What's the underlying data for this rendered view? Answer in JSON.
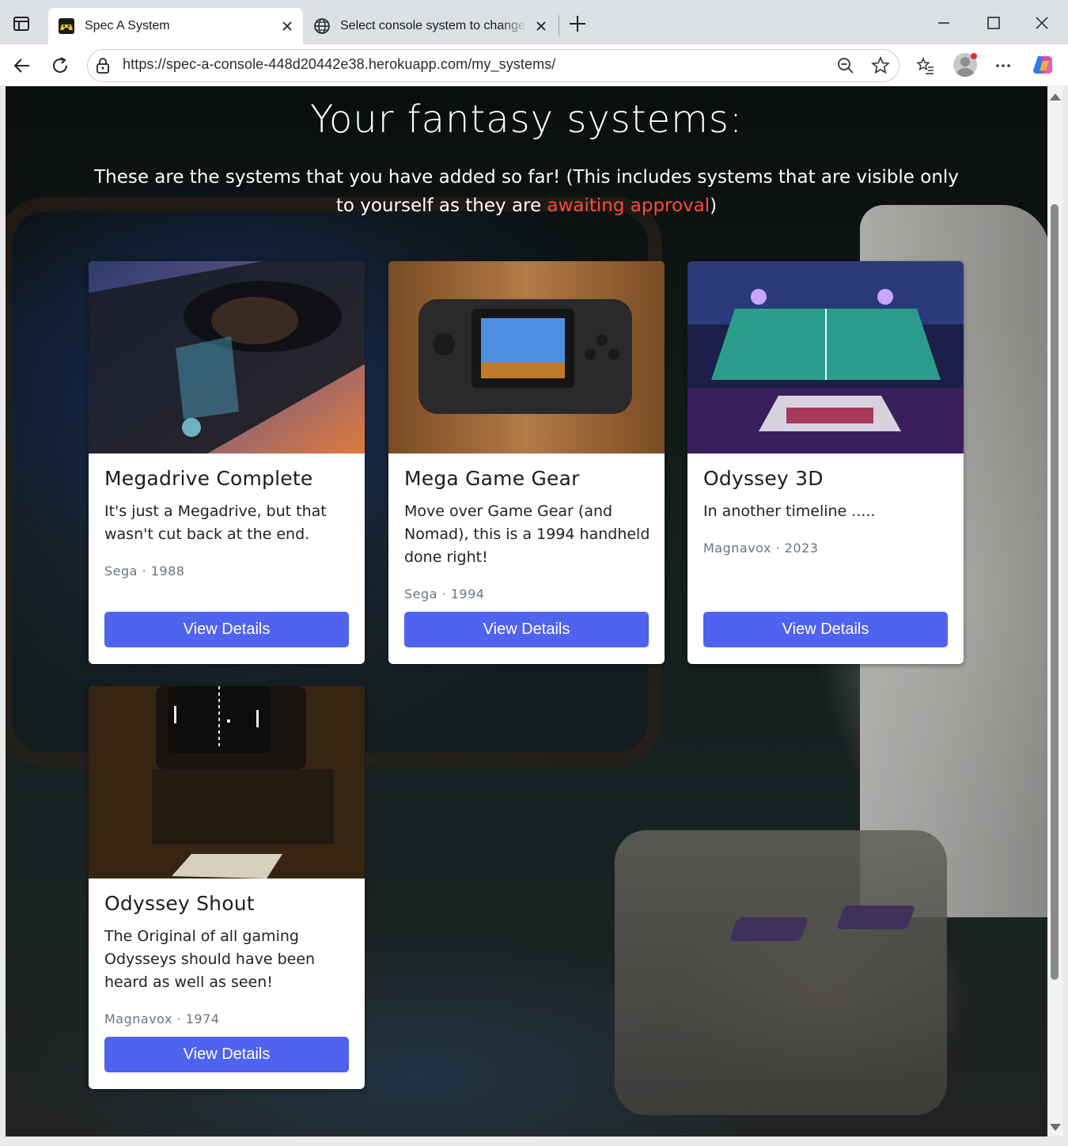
{
  "browser": {
    "active_tab_title": "Spec A System",
    "inactive_tab_title": "Select console system to change",
    "url": "https://spec-a-console-448d20442e38.herokuapp.com/my_systems/"
  },
  "page": {
    "heading": "Your fantasy systems:",
    "subtext_main": "These are the systems that you have added so far! (This includes systems that are visible only to yourself as they are ",
    "subtext_highlight": "awaiting approval",
    "subtext_end": ")",
    "highlight_color": "#ff4a3d",
    "button_color": "#4f63ee"
  },
  "systems": [
    {
      "name": "Megadrive Complete",
      "description": "It's just a Megadrive, but that wasn't cut back at the end.",
      "meta": "Sega · 1988",
      "button": "View Details",
      "image_icon": "megadrive-image"
    },
    {
      "name": "Mega Game Gear",
      "description": "Move over Game Gear (and Nomad), this is a 1994 handheld done right!",
      "meta": "Sega · 1994",
      "button": "View Details",
      "image_icon": "game-gear-image"
    },
    {
      "name": "Odyssey 3D",
      "description": "In another timeline .....",
      "meta": "Magnavox · 2023",
      "button": "View Details",
      "image_icon": "odyssey-3d-image"
    },
    {
      "name": "Odyssey Shout",
      "description": "The Original of all gaming Odysseys should have been heard as well as seen!",
      "meta": "Magnavox · 1974",
      "button": "View Details",
      "image_icon": "odyssey-shout-image"
    }
  ]
}
